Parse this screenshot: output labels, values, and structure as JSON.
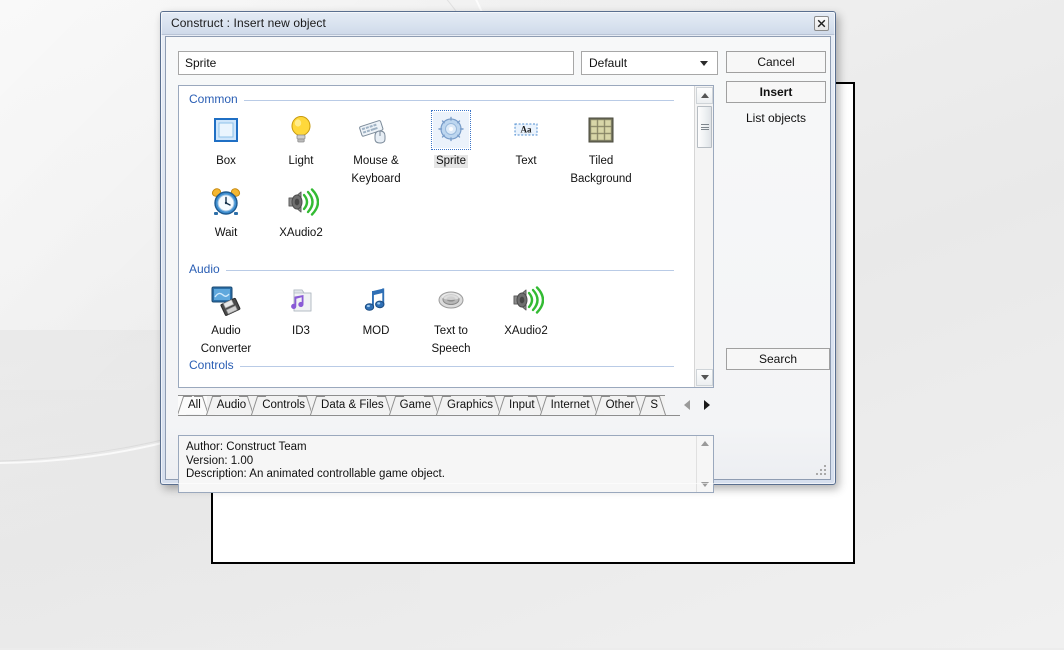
{
  "window": {
    "title": "Construct : Insert new object",
    "close_icon": "close-icon"
  },
  "topbar": {
    "name_value": "Sprite",
    "name_placeholder": "Object name",
    "combo_value": "Default",
    "combo_options": [
      "Default"
    ]
  },
  "buttons": {
    "cancel": "Cancel",
    "insert": "Insert",
    "list_objects": "List objects",
    "search": "Search"
  },
  "groups": [
    {
      "name": "Common",
      "objects": [
        {
          "label": "Box",
          "icon": "box-icon",
          "selected": false
        },
        {
          "label": "Light",
          "icon": "lightbulb-icon",
          "selected": false
        },
        {
          "label": "Mouse &\nKeyboard",
          "icon": "mouse-keyboard-icon",
          "selected": false
        },
        {
          "label": "Sprite",
          "icon": "sprite-icon",
          "selected": true
        },
        {
          "label": "Text",
          "icon": "text-icon",
          "selected": false
        },
        {
          "label": "Tiled\nBackground",
          "icon": "tiled-background-icon",
          "selected": false
        },
        {
          "label": "Wait",
          "icon": "alarm-clock-icon",
          "selected": false
        },
        {
          "label": "XAudio2",
          "icon": "speaker-icon",
          "selected": false
        }
      ]
    },
    {
      "name": "Audio",
      "objects": [
        {
          "label": "Audio\nConverter",
          "icon": "audio-converter-icon",
          "selected": false
        },
        {
          "label": "ID3",
          "icon": "id3-folder-icon",
          "selected": false
        },
        {
          "label": "MOD",
          "icon": "music-note-icon",
          "selected": false
        },
        {
          "label": "Text to\nSpeech",
          "icon": "speech-icon",
          "selected": false
        },
        {
          "label": "XAudio2",
          "icon": "speaker-icon",
          "selected": false
        }
      ]
    },
    {
      "name": "Controls",
      "objects": []
    }
  ],
  "tabs": [
    {
      "label": "All",
      "active": true
    },
    {
      "label": "Audio",
      "active": false
    },
    {
      "label": "Controls",
      "active": false
    },
    {
      "label": "Data & Files",
      "active": false
    },
    {
      "label": "Game",
      "active": false
    },
    {
      "label": "Graphics",
      "active": false
    },
    {
      "label": "Input",
      "active": false
    },
    {
      "label": "Internet",
      "active": false
    },
    {
      "label": "Other",
      "active": false
    },
    {
      "label": "S",
      "active": false
    }
  ],
  "description": {
    "author": "Author: Construct Team",
    "version": "Version: 1.00",
    "description": "Description: An animated controllable game object."
  },
  "colors": {
    "group_label": "#2a5eb4",
    "dialog_border": "#5a6f8f",
    "selection": "#3a74c8"
  }
}
